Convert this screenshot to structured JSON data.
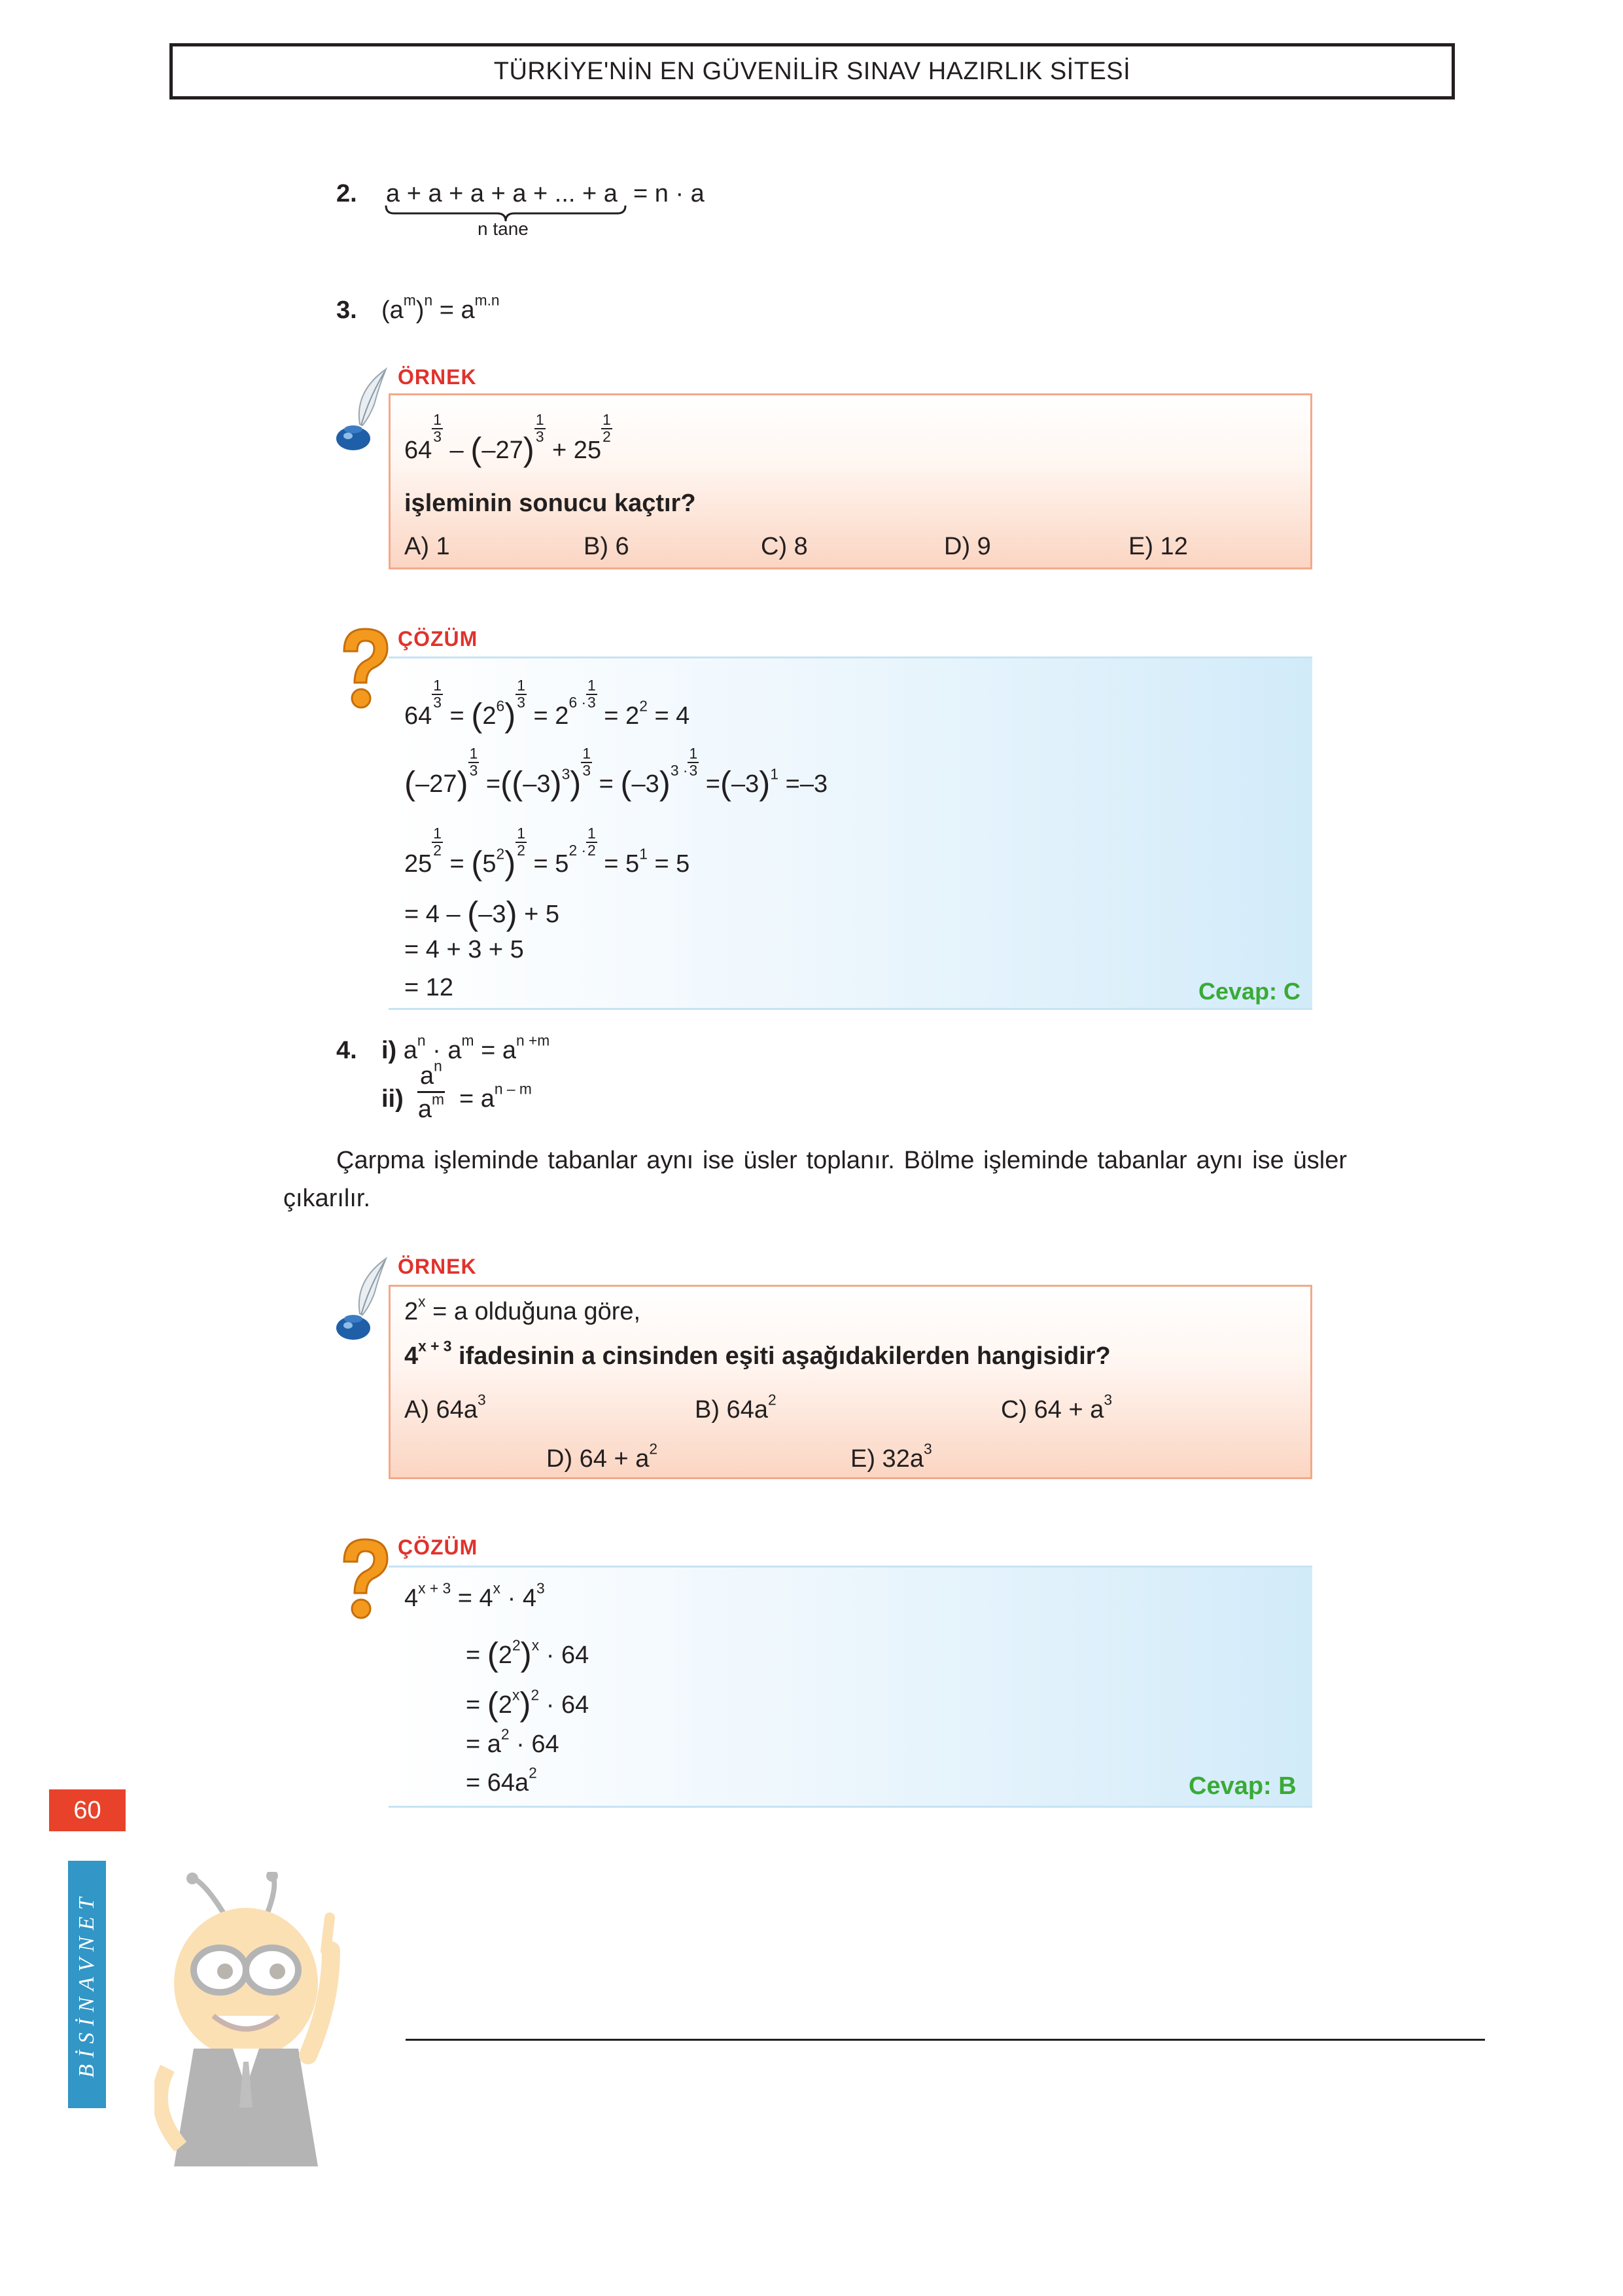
{
  "header": {
    "title": "TÜRKİYE'NİN EN GÜVENİLİR SINAV HAZIRLIK SİTESİ"
  },
  "rules": {
    "r2": {
      "num": "2.",
      "sum": "a + a + a + a + ... + a",
      "result": "= n · a",
      "brace_label": "n tane"
    },
    "r3": {
      "num": "3.",
      "base": "(a",
      "inner_exp": "m",
      "close": ")",
      "outer_exp": "n",
      "eq": " = a",
      "result_exp": "m.n"
    },
    "r4": {
      "num": "4.",
      "i_label": "i)",
      "i_base1": "a",
      "i_exp1": "n",
      "i_dot": " · a",
      "i_exp2": "m",
      "i_eq": " = a",
      "i_exp3": "n +m",
      "ii_label": "ii)",
      "ii_num": "a",
      "ii_num_exp": "n",
      "ii_den": "a",
      "ii_den_exp": "m",
      "ii_eq": "= a",
      "ii_exp": "n – m"
    }
  },
  "paragraph": "Çarpma işleminde tabanlar aynı ise üsler toplanır. Bölme işleminde tabanlar aynı ise üsler çıkarılır.",
  "example1": {
    "label": "ÖRNEK",
    "expr": {
      "t1": "64",
      "minus": " – ",
      "open": "(",
      "t2": "–27",
      "close": ")",
      "plus": " + 25",
      "one": "1",
      "three": "3",
      "two": "2"
    },
    "question": "işleminin sonucu kaçtır?",
    "options": [
      "A) 1",
      "B) 6",
      "C) 8",
      "D) 9",
      "E) 12"
    ]
  },
  "solution1": {
    "label": "ÇÖZÜM",
    "l1": {
      "a": "64",
      "b": "= ",
      "c": "2",
      "d": "6",
      "e": "= 2",
      "f": "6 ·",
      "g": "= 2",
      "h": "2",
      "i": "= 4"
    },
    "l2": {
      "a": "–27",
      "b": "=",
      "c": "–3",
      "d": "3",
      "e": "= ",
      "f": "–3",
      "g": "3 ·",
      "h": "=",
      "i": "1",
      "j": "=–3"
    },
    "l3": {
      "a": "25",
      "b": "= ",
      "c": "5",
      "d": "2",
      "e": "= 5",
      "f": "2 ·",
      "g": "= 5",
      "h": "1",
      "i": "= 5"
    },
    "l4": "= 4 – ",
    "l4b": "–3",
    "l4c": " + 5",
    "l5": "= 4 + 3 + 5",
    "l6": "= 12",
    "answer": "Cevap: C"
  },
  "example2": {
    "label": "ÖRNEK",
    "line1_base": "2",
    "line1_exp": "x",
    "line1_rest": " = a olduğuna göre,",
    "line2_base": "4",
    "line2_exp": "x + 3",
    "line2_rest": " ifadesinin a cinsinden eşiti aşağıdakilerden hangisidir?",
    "options": [
      {
        "label": "A) 64a",
        "exp": "3"
      },
      {
        "label": "B) 64a",
        "exp": "2"
      },
      {
        "label": "C) 64 + a",
        "exp": "3"
      },
      {
        "label": "D) 64 + a",
        "exp": "2"
      },
      {
        "label": "E) 32a",
        "exp": "3"
      }
    ]
  },
  "solution2": {
    "label": "ÇÖZÜM",
    "l1": {
      "a": "4",
      "ae": "x + 3",
      "b": " = 4",
      "be": "x",
      "c": " · 4",
      "ce": "3"
    },
    "l2": {
      "a": "= ",
      "b": "2",
      "be": "2",
      "oe": "x",
      "c": " · 64"
    },
    "l3": {
      "a": "= ",
      "b": "2",
      "be": "x",
      "oe": "2",
      "c": " · 64"
    },
    "l4": {
      "a": "= a",
      "ae": "2",
      "b": " · 64"
    },
    "l5": {
      "a": "= 64a",
      "ae": "2"
    },
    "answer": "Cevap: B"
  },
  "footer": {
    "page_number": "60",
    "brand": "BİSİNAVNET"
  },
  "colors": {
    "label_red": "#e0322c",
    "answer_green": "#3aaa35",
    "page_tab": "#e8432a",
    "brand_blue": "#3296c6"
  },
  "icons": [
    "quill-ink-icon",
    "question-mark-icon",
    "bee-mascot-icon"
  ]
}
